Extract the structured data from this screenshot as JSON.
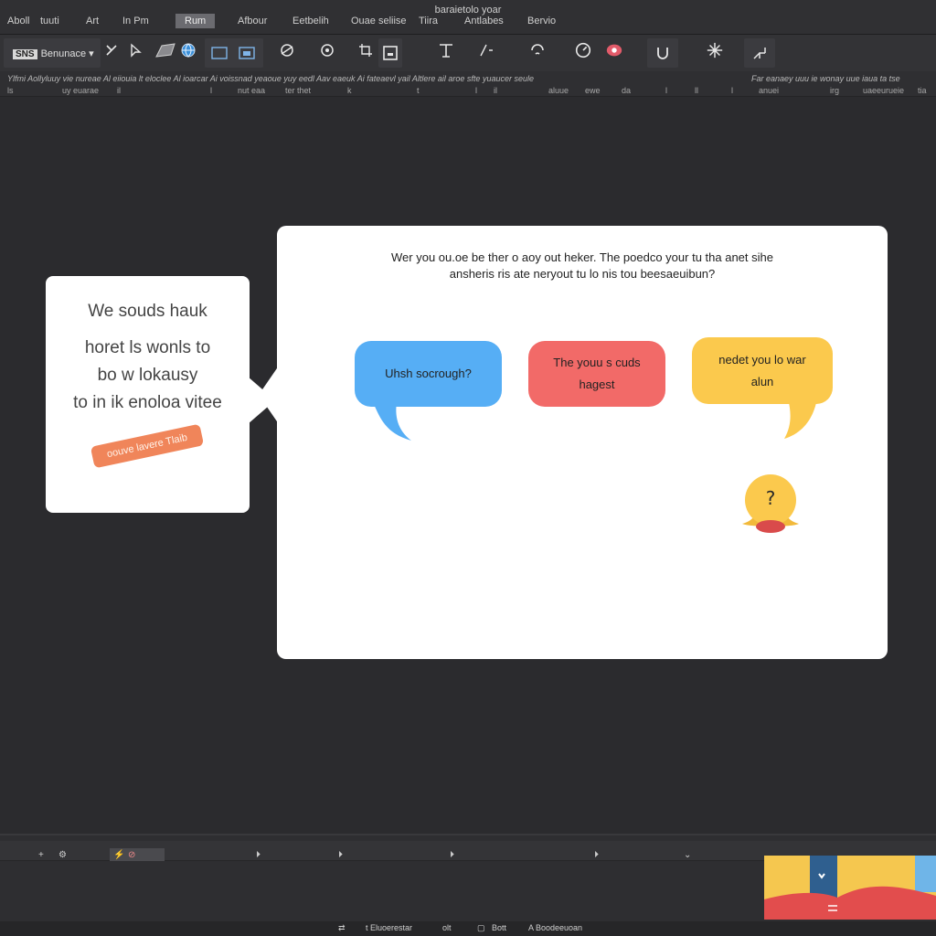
{
  "menubar": {
    "title": "baraietolo yoar",
    "items": [
      "Aboll",
      "tuuti",
      "Art",
      "In Pm",
      "Rum",
      "Afbour",
      "Eetbelih",
      "Ouae seliise",
      "Tiira",
      "Antlabes",
      "Bervio"
    ],
    "active_index": 4
  },
  "toolbar": {
    "font_badge": "SNS",
    "font_name": "Benunace",
    "icons": [
      "pen-tool-icon",
      "cursor-icon",
      "shape-icon",
      "globe-icon",
      "image-icon",
      "frame-icon",
      "layers-icon",
      "eye-icon",
      "crop-icon",
      "text-tool-icon",
      "audio-icon",
      "play-icon",
      "record-icon",
      "undo-icon",
      "settings-icon",
      "expand-icon"
    ]
  },
  "infostrip": {
    "line1": "Ylfmi Aollyluuy vie nureae Al eiiouia lt eloclee Al ioarcar Ai voissnad yeaoue yuy eedl Aav eaeuk Ai fateaevl yail Altlere ail aroe sfte yuaucer seule",
    "line1_right": "Far eanaey uuu ie wonay uue iaua ta tse",
    "line2": [
      "ls",
      "uy euarae",
      "il",
      "l",
      "nut eaa",
      "ter thet",
      "k",
      "t",
      "l",
      "il",
      "aluue",
      "ewe",
      "da",
      "l",
      "ll",
      "l",
      "anuei",
      "irg",
      "uaeeurueie",
      "tia"
    ]
  },
  "left_card": {
    "line1": "We souds hauk",
    "line2": "horet ls wonls to",
    "line3": "bo w lokausy",
    "line4": "to in ik enoloa vitee",
    "tag": "oouve lavere Tlaib"
  },
  "main_card": {
    "question_line1": "Wer you ou.oe be ther o aoy out heker. The poedco your tu tha anet sihe",
    "question_line2": "ansheris ris ate neryout tu lo nis tou beesaeuibun?",
    "bubbles": [
      {
        "text": "Uhsh socrough?",
        "color": "#56aef5"
      },
      {
        "text_line1": "The youu s cuds",
        "text_line2": "hagest",
        "color": "#f26a68"
      },
      {
        "text_line1": "nedet you lo war",
        "text_line2": "alun",
        "color": "#fbc94d"
      }
    ],
    "mascot_glyph": "?"
  },
  "timeline": {
    "markers": [
      "⏵",
      "⏵",
      "⏵",
      "⏵",
      "⏵",
      "⌄"
    ],
    "left_tools": [
      "+",
      "⚙",
      "⚡",
      "⊘"
    ]
  },
  "statusbar": {
    "items": [
      "t Eluoerestar",
      "olt",
      "Bott",
      "A Boodeeuoan"
    ]
  }
}
